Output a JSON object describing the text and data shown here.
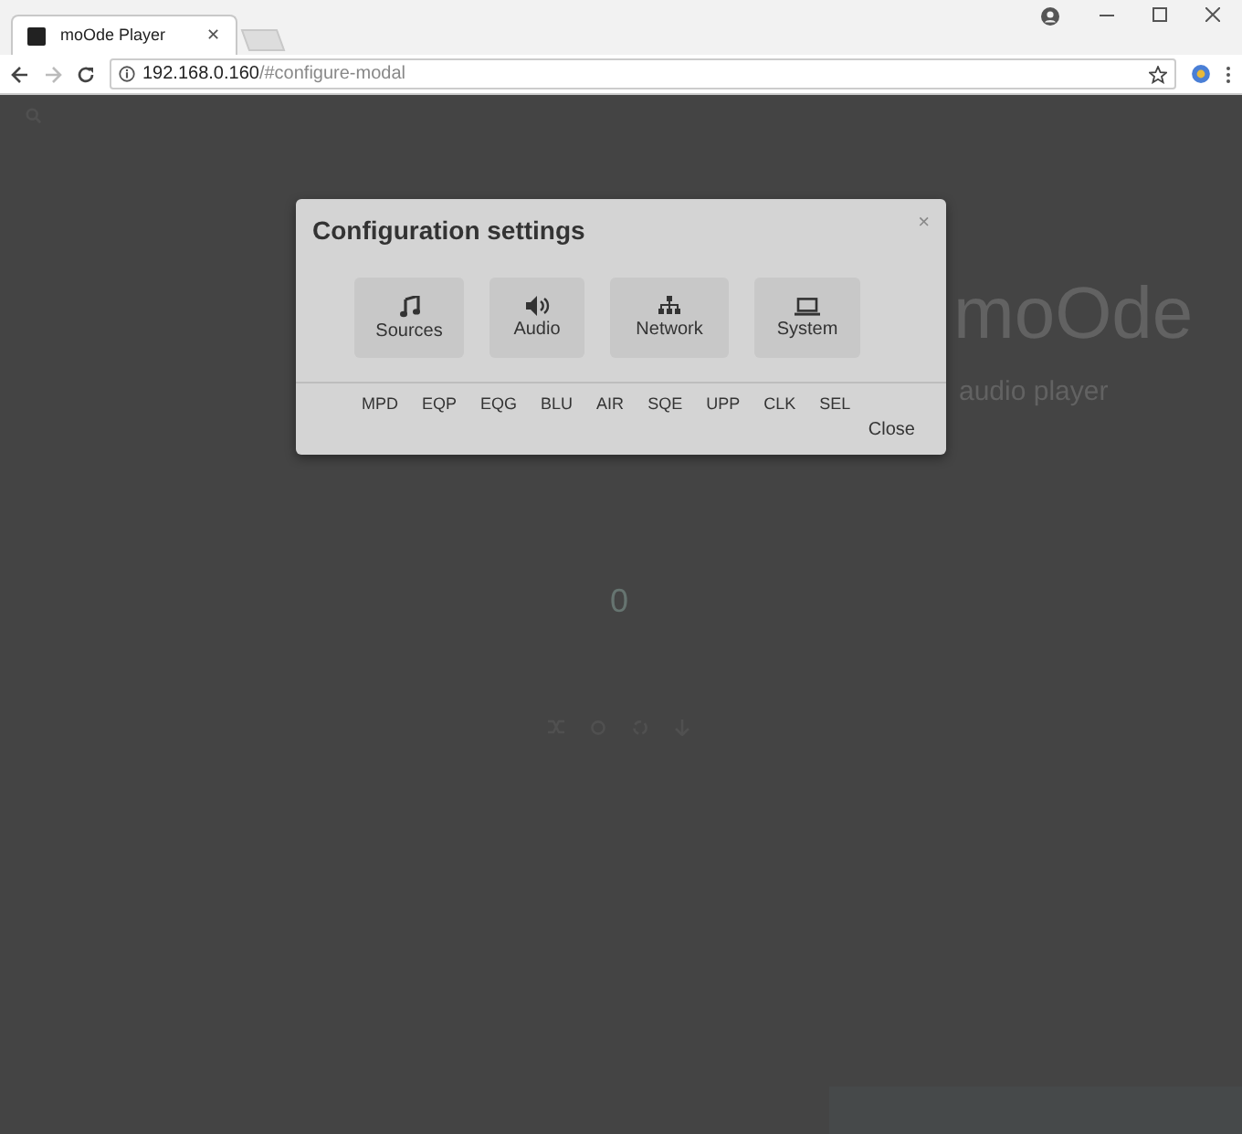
{
  "browser": {
    "tab_title": "moOde Player",
    "tab_close": "✕",
    "address_host": "192.168.0.160",
    "address_path": "/#configure-modal"
  },
  "background": {
    "logo": "moOde",
    "logo_subtitle": "audio player",
    "volume": "0"
  },
  "modal": {
    "title": "Configuration settings",
    "close_mark": "×",
    "sections": [
      {
        "label": "Sources"
      },
      {
        "label": "Audio"
      },
      {
        "label": "Network"
      },
      {
        "label": "System"
      }
    ],
    "links": [
      "MPD",
      "EQP",
      "EQG",
      "BLU",
      "AIR",
      "SQE",
      "UPP",
      "CLK",
      "SEL"
    ],
    "close_button": "Close"
  }
}
